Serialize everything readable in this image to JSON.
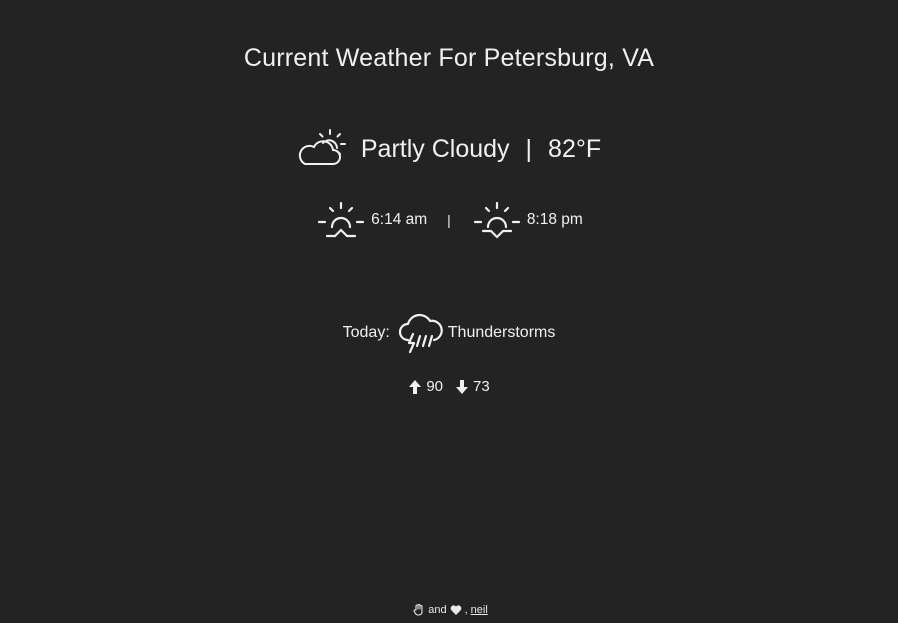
{
  "page": {
    "title": "Current Weather For Petersburg, VA"
  },
  "current": {
    "icon": "partly-cloudy-icon",
    "condition": "Partly Cloudy",
    "separator": "|",
    "temperature": "82°F"
  },
  "sun": {
    "sunrise_icon": "sunrise-icon",
    "sunrise": "6:14 am",
    "separator": "|",
    "sunset_icon": "sunset-icon",
    "sunset": "8:18 pm"
  },
  "today": {
    "label": "Today:",
    "icon": "thunderstorm-icon",
    "condition": "Thunderstorms",
    "high_icon": "arrow-up-icon",
    "high": "90",
    "low_icon": "arrow-down-icon",
    "low": "73"
  },
  "footer": {
    "hand_icon": "hand-icon",
    "and_text": "and",
    "heart_icon": "heart-icon",
    "comma": ",",
    "author_link": "neil"
  },
  "colors": {
    "background": "#232323",
    "text": "#f0f0f0"
  }
}
